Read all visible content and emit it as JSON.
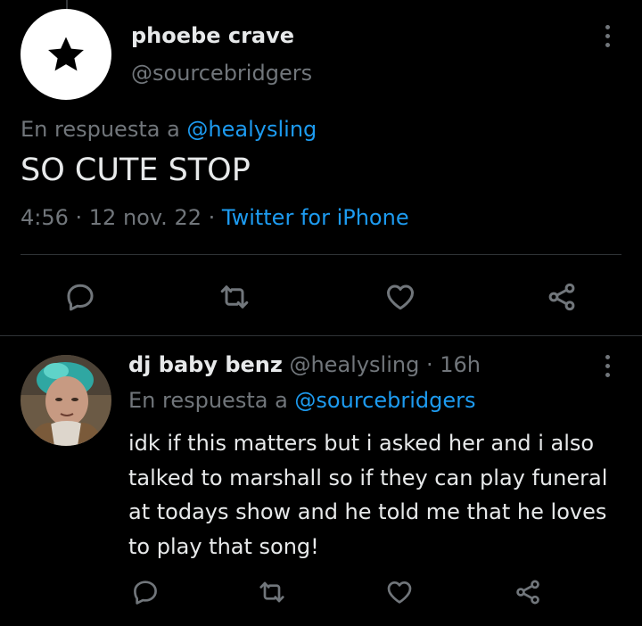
{
  "main_tweet": {
    "display_name": "phoebe crave",
    "handle": "@sourcebridgers",
    "reply_prefix": "En respuesta a",
    "reply_to": "@healysling",
    "text": "SO CUTE STOP",
    "time_date": "4:56 · 12 nov. 22 · ",
    "source": "Twitter for iPhone",
    "avatar_icon": "star-icon"
  },
  "reply_tweet": {
    "display_name": "dj baby benz",
    "handle_time": "@healysling · 16h",
    "reply_prefix": "En respuesta a",
    "reply_to": "@sourcebridgers",
    "text": "idk if this matters but i asked her and i also talked to marshall so if they can play funeral at todays show and he told me that he loves to play that song!"
  },
  "actions": [
    "reply-icon",
    "retweet-icon",
    "like-icon",
    "share-icon"
  ],
  "colors": {
    "background": "#000000",
    "text_primary": "#e7e9ea",
    "text_secondary": "#71767b",
    "link": "#1d9bf0",
    "divider": "#2f3336"
  }
}
